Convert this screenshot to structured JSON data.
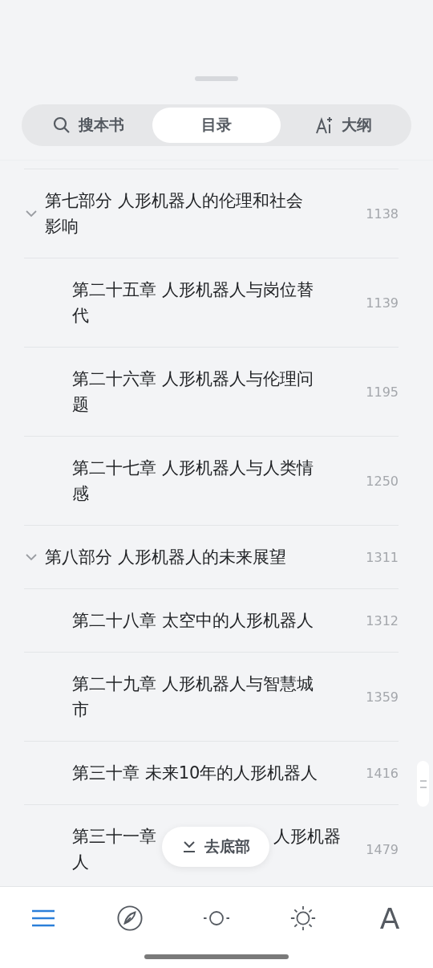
{
  "tabs": [
    {
      "label": "搜本书",
      "selected": false
    },
    {
      "label": "目录",
      "selected": true
    },
    {
      "label": "大纲",
      "selected": false
    }
  ],
  "toc": [
    {
      "kind": "part",
      "title": "第七部分 人形机器人的伦理和社会影响",
      "page": "1138",
      "expanded": true
    },
    {
      "kind": "chapter",
      "title": "第二十五章 人形机器人与岗位替代",
      "page": "1139"
    },
    {
      "kind": "chapter",
      "title": "第二十六章 人形机器人与伦理问题",
      "page": "1195"
    },
    {
      "kind": "chapter",
      "title": "第二十七章 人形机器人与人类情感",
      "page": "1250"
    },
    {
      "kind": "part",
      "title": "第八部分 人形机器人的未来展望",
      "page": "1311",
      "expanded": true
    },
    {
      "kind": "chapter",
      "title": "第二十八章 太空中的人形机器人",
      "page": "1312"
    },
    {
      "kind": "chapter",
      "title": "第二十九章 人形机器人与智慧城市",
      "page": "1359"
    },
    {
      "kind": "chapter",
      "title": "第三十章 未来10年的人形机器人",
      "page": "1416"
    },
    {
      "kind": "chapter",
      "title_parts": [
        "第三十一章",
        "人形机器",
        "人"
      ],
      "page": "1479"
    }
  ],
  "go_bottom_button": "去底部",
  "bottom_nav": [
    {
      "kind": "menu",
      "selected": true
    },
    {
      "kind": "compass",
      "selected": false
    },
    {
      "kind": "progress",
      "selected": false
    },
    {
      "kind": "brightness",
      "selected": false
    },
    {
      "kind": "font",
      "label": "A",
      "selected": false
    }
  ]
}
